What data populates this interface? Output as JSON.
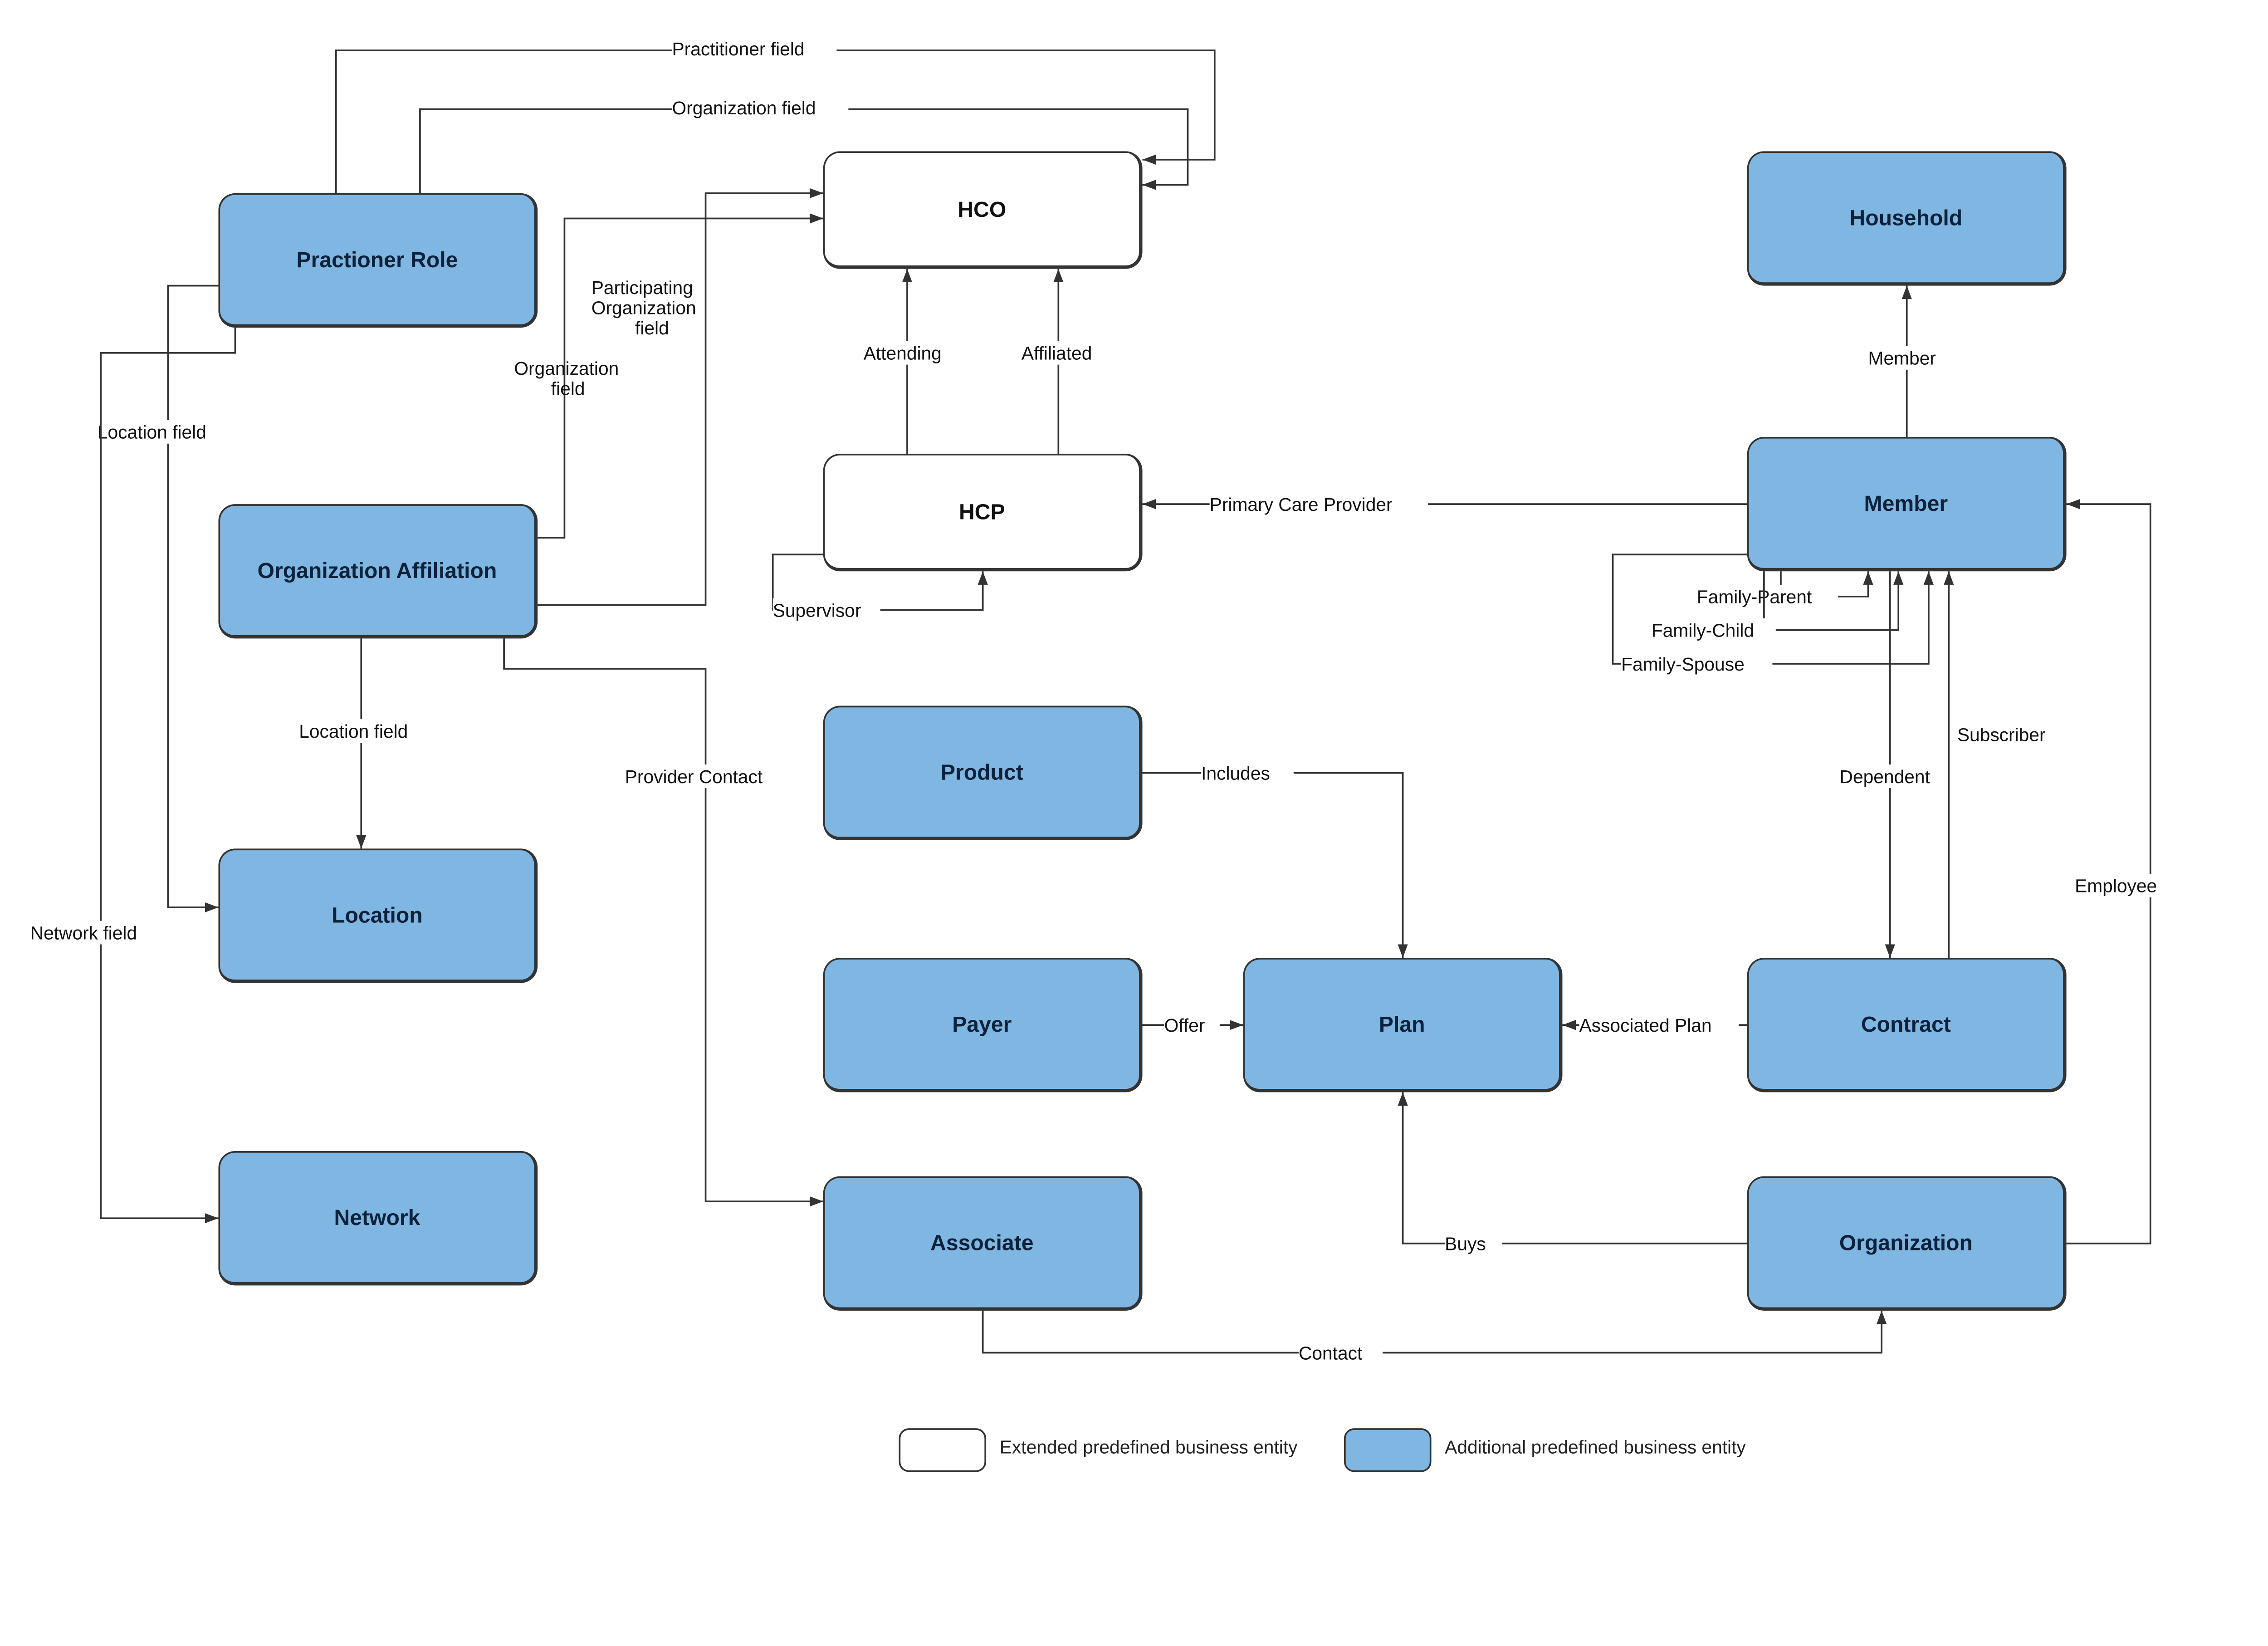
{
  "nodes": {
    "practitioner_role": "Practioner Role",
    "organization_affiliation": "Organization Affiliation",
    "location": "Location",
    "network": "Network",
    "hco": "HCO",
    "hcp": "HCP",
    "product": "Product",
    "payer": "Payer",
    "associate": "Associate",
    "plan": "Plan",
    "household": "Household",
    "member": "Member",
    "contract": "Contract",
    "organization": "Organization"
  },
  "edges": {
    "practitioner_field": "Practitioner field",
    "organization_field_top": "Organization field",
    "participating_organization_field": "Participating\nOrganization\nfield",
    "organization_field_left": "Organization\nfield",
    "location_field_top": "Location field",
    "location_field_mid": "Location field",
    "network_field": "Network field",
    "attending": "Attending",
    "affiliated": "Affiliated",
    "supervisor": "Supervisor",
    "primary_care_provider": "Primary Care Provider",
    "member": "Member",
    "family_parent": "Family-Parent",
    "family_child": "Family-Child",
    "family_spouse": "Family-Spouse",
    "subscriber": "Subscriber",
    "dependent": "Dependent",
    "employee": "Employee",
    "provider_contact": "Provider Contact",
    "includes": "Includes",
    "offer": "Offer",
    "associated_plan": "Associated Plan",
    "buys": "Buys",
    "contact": "Contact"
  },
  "legend": {
    "extended": "Extended predefined business entity",
    "additional": "Additional predefined business entity"
  }
}
